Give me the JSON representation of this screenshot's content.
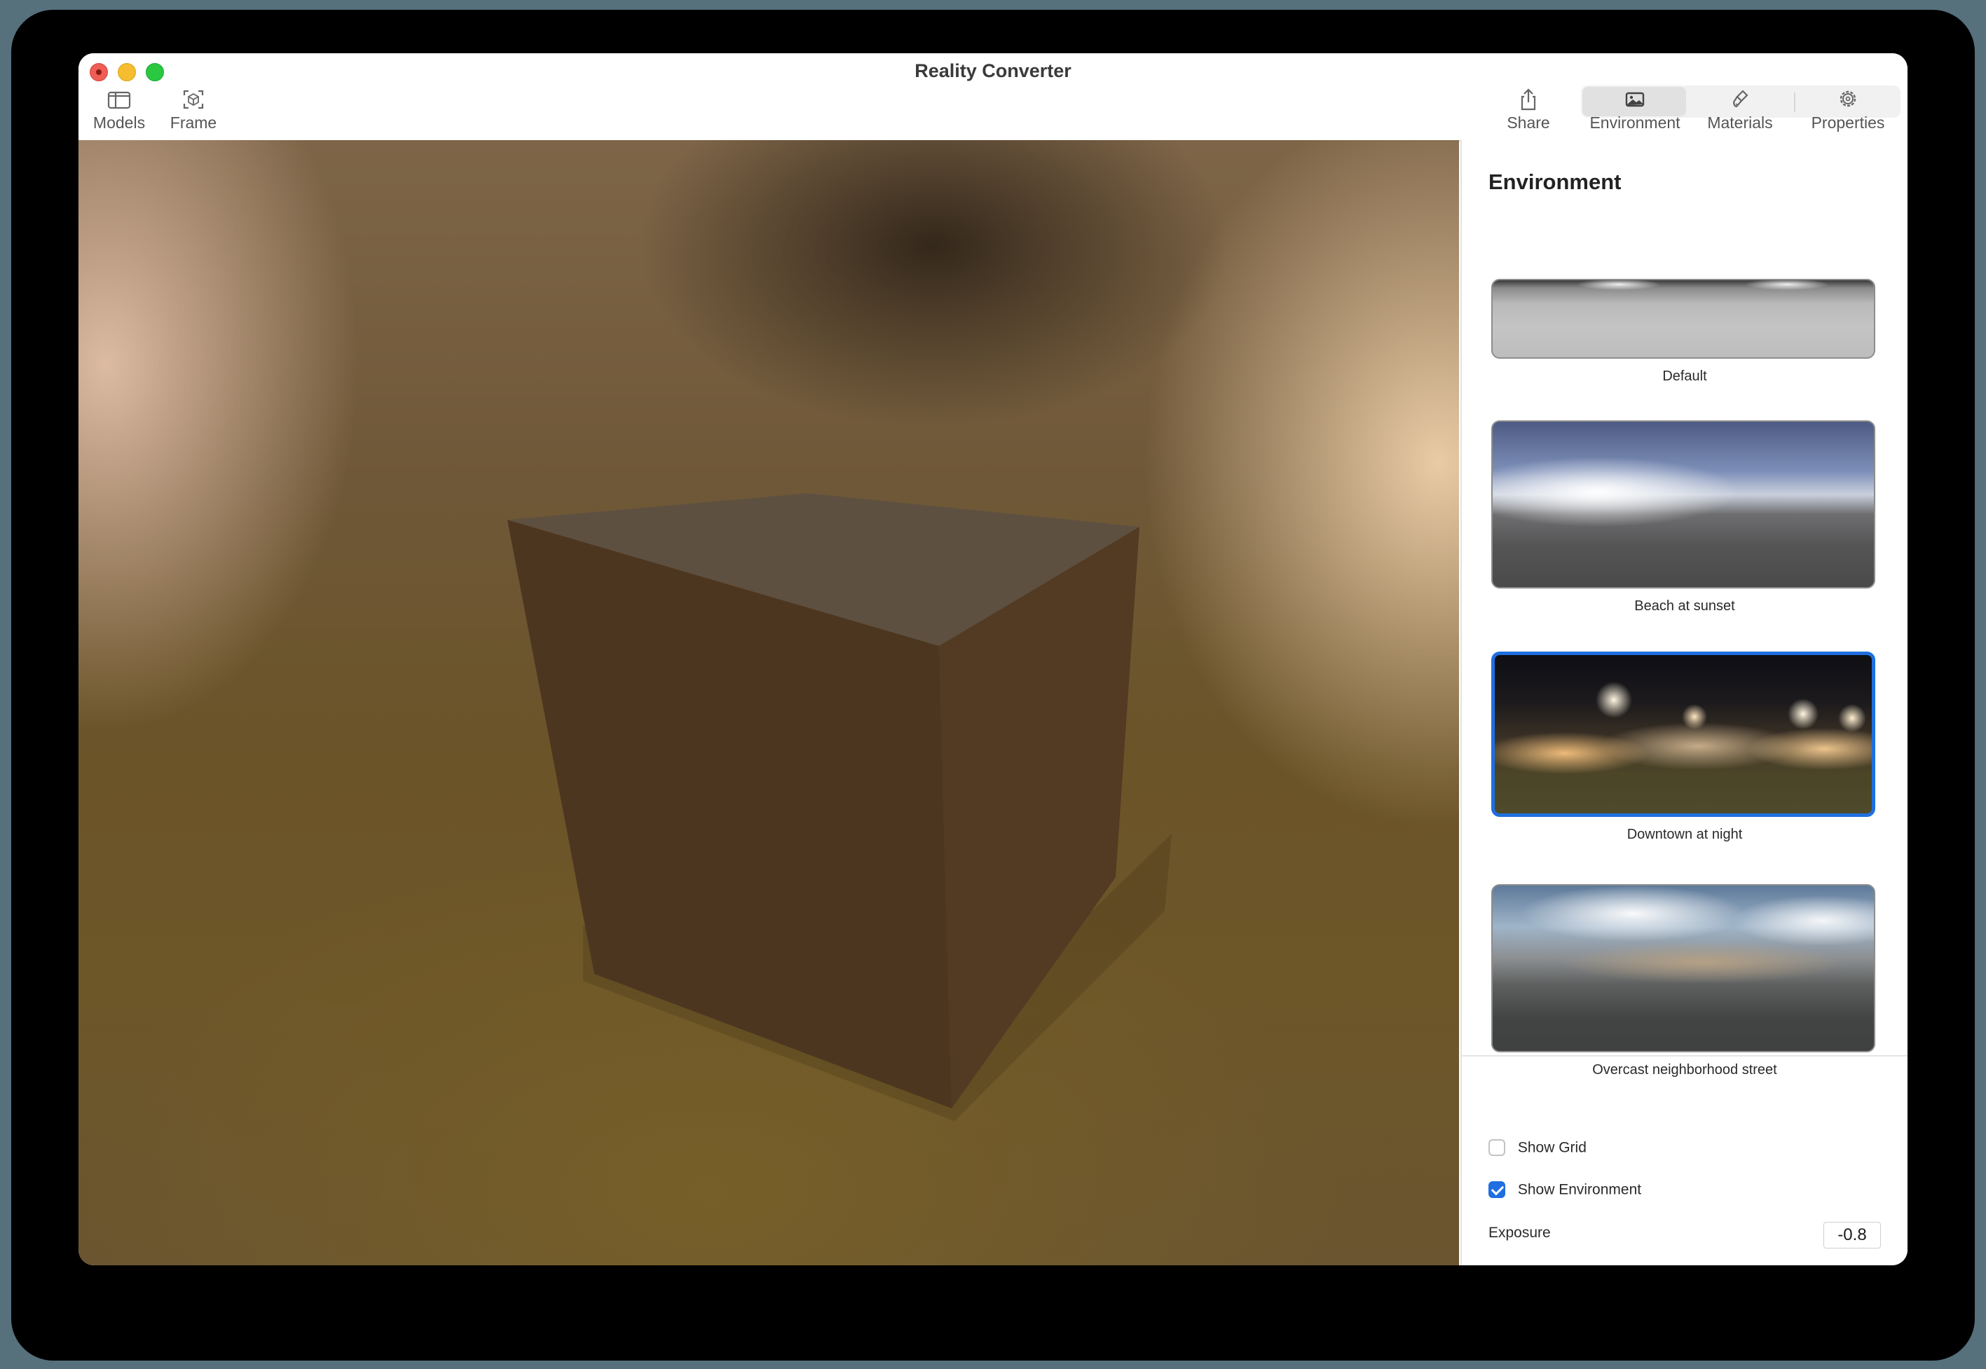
{
  "window": {
    "title": "Reality Converter"
  },
  "toolbar": {
    "left": [
      {
        "label": "Models",
        "icon": "sidebar-icon"
      },
      {
        "label": "Frame",
        "icon": "frame-icon"
      }
    ],
    "share": {
      "label": "Share",
      "icon": "share-icon"
    },
    "segments": [
      {
        "label": "Environment",
        "icon": "photo-icon",
        "selected": true
      },
      {
        "label": "Materials",
        "icon": "paintbrush-icon",
        "selected": false
      },
      {
        "label": "Properties",
        "icon": "gear-icon",
        "selected": false
      }
    ]
  },
  "panel": {
    "title": "Environment",
    "environments": [
      {
        "label": "Default",
        "selected": false
      },
      {
        "label": "Beach at sunset",
        "selected": false
      },
      {
        "label": "Downtown at night",
        "selected": true
      },
      {
        "label": "Overcast neighborhood street",
        "selected": false
      }
    ],
    "show_grid": {
      "label": "Show Grid",
      "checked": false
    },
    "show_environment": {
      "label": "Show Environment",
      "checked": true
    },
    "exposure": {
      "label": "Exposure",
      "value": "-0.8"
    }
  },
  "colors": {
    "accent": "#1f6fe0",
    "close": "#ee5d56",
    "minimize": "#f5bd2f",
    "maximize": "#29c840"
  }
}
